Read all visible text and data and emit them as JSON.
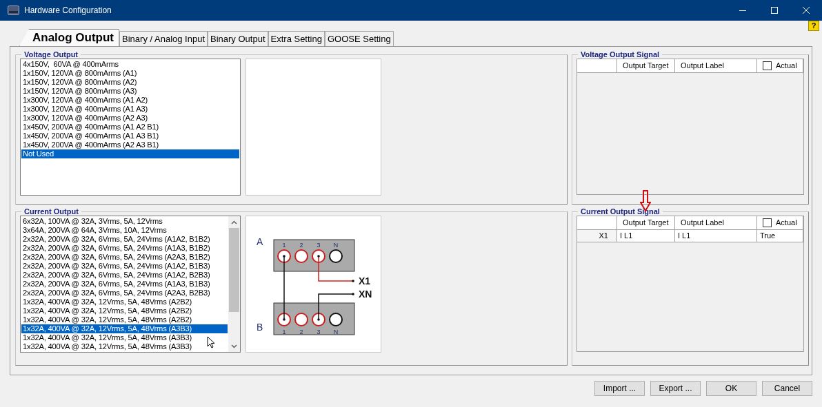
{
  "window": {
    "title": "Hardware Configuration",
    "help_button": "?"
  },
  "tabs": [
    {
      "label": "Analog Output",
      "selected": true
    },
    {
      "label": "Binary / Analog Input",
      "selected": false
    },
    {
      "label": "Binary Output",
      "selected": false
    },
    {
      "label": "Extra Setting",
      "selected": false
    },
    {
      "label": "GOOSE Setting",
      "selected": false
    }
  ],
  "voltage_output": {
    "title": "Voltage Output",
    "items": [
      {
        "label": "4x150V,  60VA @ 400mArms",
        "selected": false
      },
      {
        "label": "1x150V, 120VA @ 800mArms (A1)",
        "selected": false
      },
      {
        "label": "1x150V, 120VA @ 800mArms (A2)",
        "selected": false
      },
      {
        "label": "1x150V, 120VA @ 800mArms (A3)",
        "selected": false
      },
      {
        "label": "1x300V, 120VA @ 400mArms (A1 A2)",
        "selected": false
      },
      {
        "label": "1x300V, 120VA @ 400mArms (A1 A3)",
        "selected": false
      },
      {
        "label": "1x300V, 120VA @ 400mArms (A2 A3)",
        "selected": false
      },
      {
        "label": "1x450V, 200VA @ 400mArms (A1 A2 B1)",
        "selected": false
      },
      {
        "label": "1x450V, 200VA @ 400mArms (A1 A3 B1)",
        "selected": false
      },
      {
        "label": "1x450V, 200VA @ 400mArms (A2 A3 B1)",
        "selected": false
      },
      {
        "label": "Not Used",
        "selected": true
      }
    ]
  },
  "voltage_output_signal": {
    "title": "Voltage Output Signal",
    "columns": [
      {
        "label": "Output Target"
      },
      {
        "label": "Output Label"
      },
      {
        "label": "Actual",
        "checked": false
      }
    ]
  },
  "current_output": {
    "title": "Current Output",
    "items": [
      {
        "label": "6x32A, 100VA @ 32A, 3Vrms, 5A, 12Vrms",
        "selected": false
      },
      {
        "label": "3x64A, 200VA @ 64A, 3Vrms, 10A, 12Vrms",
        "selected": false
      },
      {
        "label": "2x32A, 200VA @ 32A, 6Vrms, 5A, 24Vrms (A1A2, B1B2)",
        "selected": false
      },
      {
        "label": "2x32A, 200VA @ 32A, 6Vrms, 5A, 24Vrms (A1A3, B1B2)",
        "selected": false
      },
      {
        "label": "2x32A, 200VA @ 32A, 6Vrms, 5A, 24Vrms (A2A3, B1B2)",
        "selected": false
      },
      {
        "label": "2x32A, 200VA @ 32A, 6Vrms, 5A, 24Vrms (A1A2, B1B3)",
        "selected": false
      },
      {
        "label": "2x32A, 200VA @ 32A, 6Vrms, 5A, 24Vrms (A1A2, B2B3)",
        "selected": false
      },
      {
        "label": "2x32A, 200VA @ 32A, 6Vrms, 5A, 24Vrms (A1A3, B1B3)",
        "selected": false
      },
      {
        "label": "2x32A, 200VA @ 32A, 6Vrms, 5A, 24Vrms (A2A3, B2B3)",
        "selected": false
      },
      {
        "label": "1x32A, 400VA @ 32A, 12Vrms, 5A, 48Vrms (A2B2)",
        "selected": false
      },
      {
        "label": "1x32A, 400VA @ 32A, 12Vrms, 5A, 48Vrms (A2B2)",
        "selected": false
      },
      {
        "label": "1x32A, 400VA @ 32A, 12Vrms, 5A, 48Vrms (A2B2)",
        "selected": false
      },
      {
        "label": "1x32A, 400VA @ 32A, 12Vrms, 5A, 48Vrms (A3B3)",
        "selected": true
      },
      {
        "label": "1x32A, 400VA @ 32A, 12Vrms, 5A, 48Vrms (A3B3)",
        "selected": false
      },
      {
        "label": "1x32A, 400VA @ 32A, 12Vrms, 5A, 48Vrms (A3B3)",
        "selected": false
      }
    ],
    "diagram": {
      "blocks": [
        {
          "label": "A",
          "terminals": [
            {
              "label": "1",
              "kind": "phase"
            },
            {
              "label": "2",
              "kind": "phase"
            },
            {
              "label": "3",
              "kind": "phase"
            },
            {
              "label": "N",
              "kind": "neutral"
            }
          ]
        },
        {
          "label": "B",
          "terminals": [
            {
              "label": "1",
              "kind": "phase"
            },
            {
              "label": "2",
              "kind": "phase"
            },
            {
              "label": "3",
              "kind": "phase"
            },
            {
              "label": "N",
              "kind": "neutral"
            }
          ]
        }
      ],
      "outputs": [
        "X1",
        "XN"
      ]
    }
  },
  "current_output_signal": {
    "title": "Current Output Signal",
    "columns": [
      {
        "label": "Output Target"
      },
      {
        "label": "Output Label"
      },
      {
        "label": "Actual",
        "checked": false
      }
    ],
    "rows": [
      {
        "header": "X1",
        "cells": [
          "I L1",
          "I L1",
          "True"
        ]
      }
    ]
  },
  "buttons": [
    "Import ...",
    "Export ...",
    "OK",
    "Cancel"
  ]
}
